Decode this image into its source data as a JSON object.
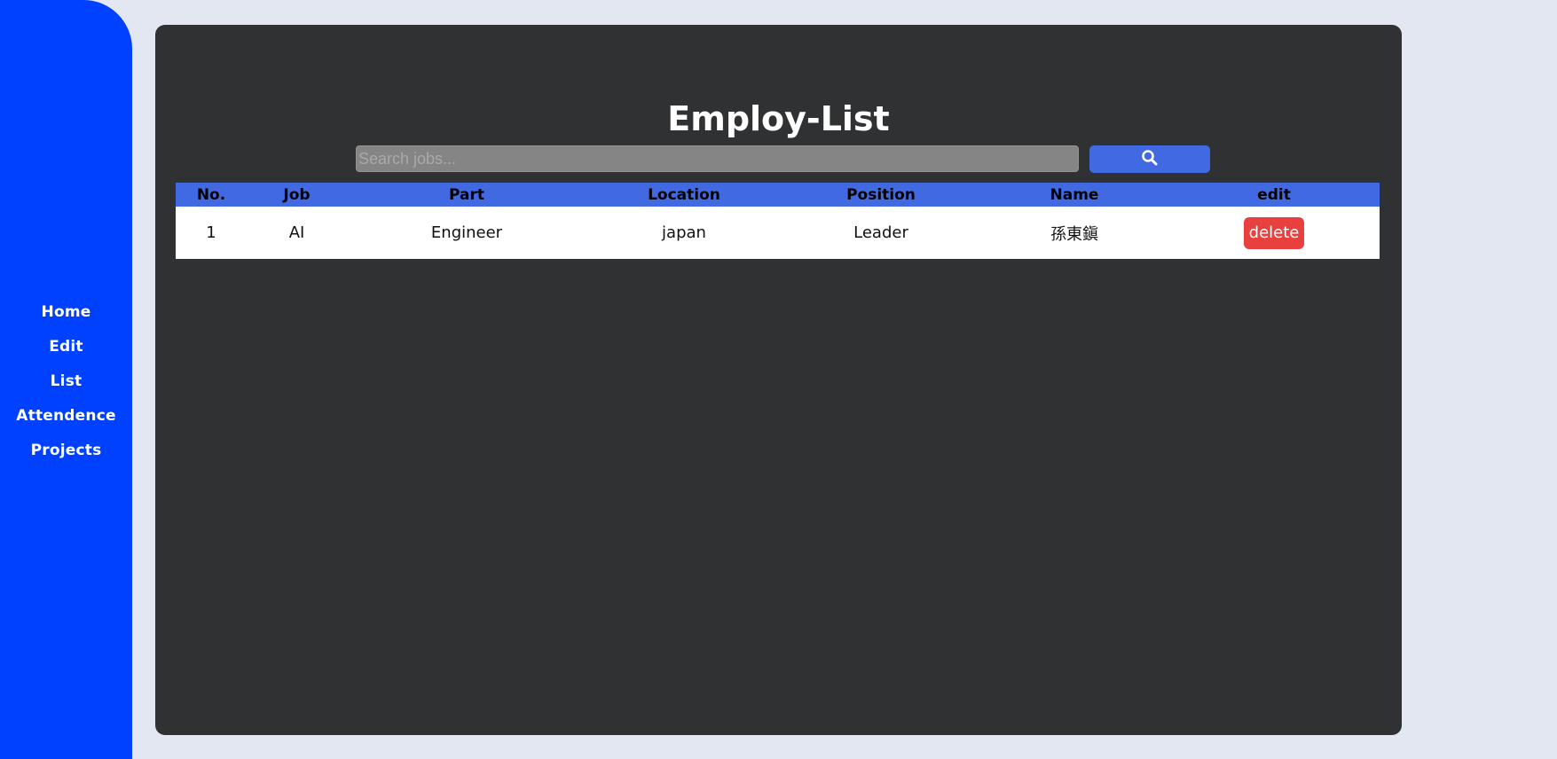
{
  "sidebar": {
    "items": [
      {
        "label": "Home"
      },
      {
        "label": "Edit"
      },
      {
        "label": "List"
      },
      {
        "label": "Attendence"
      },
      {
        "label": "Projects"
      }
    ]
  },
  "main": {
    "title": "Employ-List",
    "search": {
      "placeholder": "Search jobs...",
      "value": "",
      "button_icon": "search-icon"
    },
    "table": {
      "headers": [
        "No.",
        "Job",
        "Part",
        "Location",
        "Position",
        "Name",
        "edit"
      ],
      "rows": [
        {
          "no": "1",
          "job": "AI",
          "part": "Engineer",
          "location": "japan",
          "position": "Leader",
          "name": "孫東鎭",
          "action_label": "delete"
        }
      ]
    }
  },
  "colors": {
    "sidebar": "#0040ff",
    "background": "#e3e7f2",
    "panel": "#303133",
    "accent": "#4169e1",
    "danger": "#e8403f"
  }
}
